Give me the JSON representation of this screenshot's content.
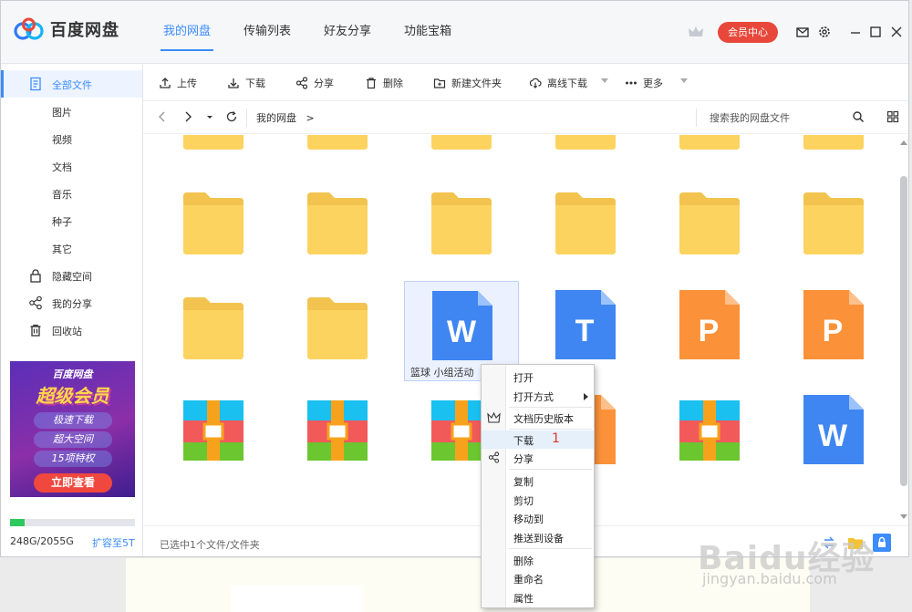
{
  "app": {
    "name": "百度网盘"
  },
  "nav": {
    "tabs": [
      {
        "label": "我的网盘",
        "active": true
      },
      {
        "label": "传输列表",
        "active": false
      },
      {
        "label": "好友分享",
        "active": false
      },
      {
        "label": "功能宝箱",
        "active": false
      }
    ]
  },
  "header": {
    "vip_button": "会员中心",
    "accent": "#3b8cff",
    "vip_color": "#e8483b"
  },
  "sidebar": {
    "items": [
      {
        "label": "全部文件",
        "icon": "document-icon"
      },
      {
        "label": "图片",
        "icon": ""
      },
      {
        "label": "视频",
        "icon": ""
      },
      {
        "label": "文档",
        "icon": ""
      },
      {
        "label": "音乐",
        "icon": ""
      },
      {
        "label": "种子",
        "icon": ""
      },
      {
        "label": "其它",
        "icon": ""
      },
      {
        "label": "隐藏空间",
        "icon": "lock-icon"
      },
      {
        "label": "我的分享",
        "icon": "share-icon"
      },
      {
        "label": "回收站",
        "icon": "trash-icon"
      }
    ]
  },
  "ad": {
    "brand": "百度网盘",
    "title": "超级会员",
    "lines": [
      "极速下载",
      "超大空间",
      "15项特权"
    ],
    "button": "立即查看"
  },
  "quota": {
    "used": "248G/2055G",
    "fraction": 0.12,
    "expand": "扩容至5T"
  },
  "toolbar": {
    "buttons": [
      "上传",
      "下载",
      "分享",
      "删除",
      "新建文件夹",
      "离线下载",
      "更多"
    ]
  },
  "addressbar": {
    "path": "我的网盘",
    "separator": ">",
    "search_placeholder": "搜索我的网盘文件"
  },
  "files": {
    "items": [
      {
        "type": "folder",
        "name": ""
      },
      {
        "type": "folder",
        "name": ""
      },
      {
        "type": "folder",
        "name": ""
      },
      {
        "type": "folder",
        "name": ""
      },
      {
        "type": "folder",
        "name": ""
      },
      {
        "type": "folder",
        "name": ""
      },
      {
        "type": "folder",
        "name": ""
      },
      {
        "type": "folder",
        "name": ""
      },
      {
        "type": "folder",
        "name": ""
      },
      {
        "type": "folder",
        "name": ""
      },
      {
        "type": "folder",
        "name": ""
      },
      {
        "type": "folder",
        "name": ""
      },
      {
        "type": "folder",
        "name": ""
      },
      {
        "type": "folder",
        "name": ""
      },
      {
        "type": "word",
        "name": "篮球 小组活动",
        "selected": true
      },
      {
        "type": "txt",
        "name": ""
      },
      {
        "type": "ppt",
        "name": ""
      },
      {
        "type": "ppt",
        "name": ""
      },
      {
        "type": "zip",
        "name": ""
      },
      {
        "type": "zip",
        "name": ""
      },
      {
        "type": "zip",
        "name": ""
      },
      {
        "type": "ppt",
        "name": ""
      },
      {
        "type": "zip",
        "name": ""
      },
      {
        "type": "word",
        "name": ""
      }
    ]
  },
  "status": {
    "text": "已选中1个文件/文件夹"
  },
  "context_menu": {
    "items": [
      "打开",
      "打开方式",
      "文档历史版本",
      "下载",
      "分享",
      "复制",
      "剪切",
      "移动到",
      "推送到设备",
      "删除",
      "重命名",
      "属性"
    ],
    "highlighted": "下载"
  },
  "annotation": {
    "text": "1"
  },
  "watermark": {
    "text": "Baidu经验",
    "sub": "jingyan.baidu.com"
  }
}
